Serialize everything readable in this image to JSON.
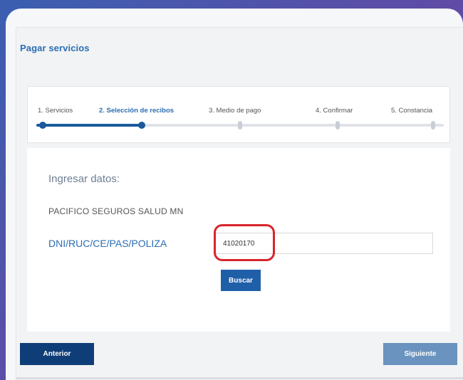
{
  "page": {
    "title": "Pagar servicios"
  },
  "stepper": {
    "steps": [
      {
        "label": "1. Servicios",
        "state": "done"
      },
      {
        "label": "2. Selección de recibos",
        "state": "current"
      },
      {
        "label": "3. Medio de pago",
        "state": "pending"
      },
      {
        "label": "4. Confirmar",
        "state": "pending"
      },
      {
        "label": "5. Constancia",
        "state": "pending"
      }
    ]
  },
  "form": {
    "section_title": "Ingresar datos:",
    "company": "PACIFICO SEGUROS SALUD MN",
    "field_label": "DNI/RUC/CE/PAS/POLIZA",
    "field_value": "41020170",
    "search_label": "Buscar"
  },
  "nav": {
    "prev_label": "Anterior",
    "next_label": "Siguiente"
  },
  "colors": {
    "primary": "#1f5fa8",
    "dark_primary": "#0f3d77",
    "disabled_primary": "#6a93bf",
    "highlight": "#d9242b"
  }
}
